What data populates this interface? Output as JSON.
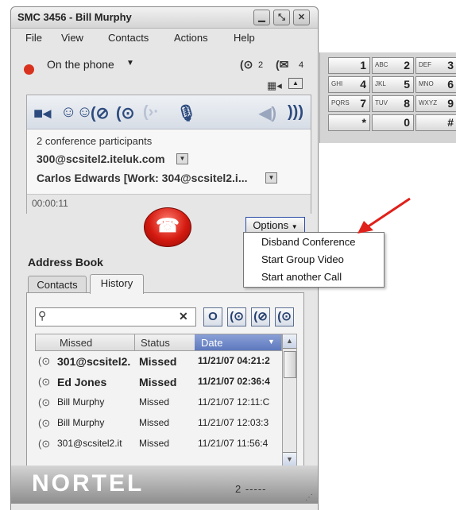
{
  "window": {
    "title": "SMC 3456 - Bill Murphy",
    "controls": [
      "minimize-icon",
      "restore-icon",
      "close-icon"
    ]
  },
  "menu": [
    "File",
    "View",
    "Contacts",
    "Actions",
    "Help"
  ],
  "status": {
    "label": "On the phone",
    "calls_count": "2",
    "messages_count": "4"
  },
  "call": {
    "participants_text": "2 conference participants",
    "participant_1": "300@scsitel2.iteluk.com",
    "participant_2": "Carlos  Edwards [Work: 304@scsitel2.i...",
    "timer": "00:00:11",
    "options_label": "Options"
  },
  "options_menu": [
    "Disband Conference",
    "Start Group Video",
    "Start another Call"
  ],
  "address_book": {
    "title": "Address Book",
    "tabs": [
      "Contacts",
      "History"
    ],
    "active_tab": "History",
    "search_value": "",
    "clear_label": "✕",
    "columns": [
      "Missed",
      "Status",
      "Date"
    ],
    "rows": [
      {
        "name": "301@scsitel2.",
        "status": "Missed",
        "date": "11/21/07 04:21:2",
        "bold": true
      },
      {
        "name": "Ed Jones",
        "status": "Missed",
        "date": "11/21/07 02:36:4",
        "bold": true
      },
      {
        "name": "Bill Murphy",
        "status": "Missed",
        "date": "11/21/07 12:11:C",
        "bold": false
      },
      {
        "name": "Bill Murphy",
        "status": "Missed",
        "date": "11/21/07 12:03:3",
        "bold": false
      },
      {
        "name": "301@scsitel2.it",
        "status": "Missed",
        "date": "11/21/07 11:56:4",
        "bold": false
      }
    ]
  },
  "footer": {
    "logo": "NORTEL",
    "page_indicator": "2 -----"
  },
  "dialpad": [
    {
      "letters": "",
      "digit": "1"
    },
    {
      "letters": "ABC",
      "digit": "2"
    },
    {
      "letters": "DEF",
      "digit": "3"
    },
    {
      "letters": "GHI",
      "digit": "4"
    },
    {
      "letters": "JKL",
      "digit": "5"
    },
    {
      "letters": "MNO",
      "digit": "6"
    },
    {
      "letters": "PQRS",
      "digit": "7"
    },
    {
      "letters": "TUV",
      "digit": "8"
    },
    {
      "letters": "WXYZ",
      "digit": "9"
    },
    {
      "letters": "",
      "digit": "*"
    },
    {
      "letters": "",
      "digit": "0"
    },
    {
      "letters": "",
      "digit": "#"
    }
  ],
  "colors": {
    "hangup": "#d41a10",
    "arrow": "#e0201a",
    "selected_column": "#6a83c4",
    "status_busy": "#d8321e"
  }
}
